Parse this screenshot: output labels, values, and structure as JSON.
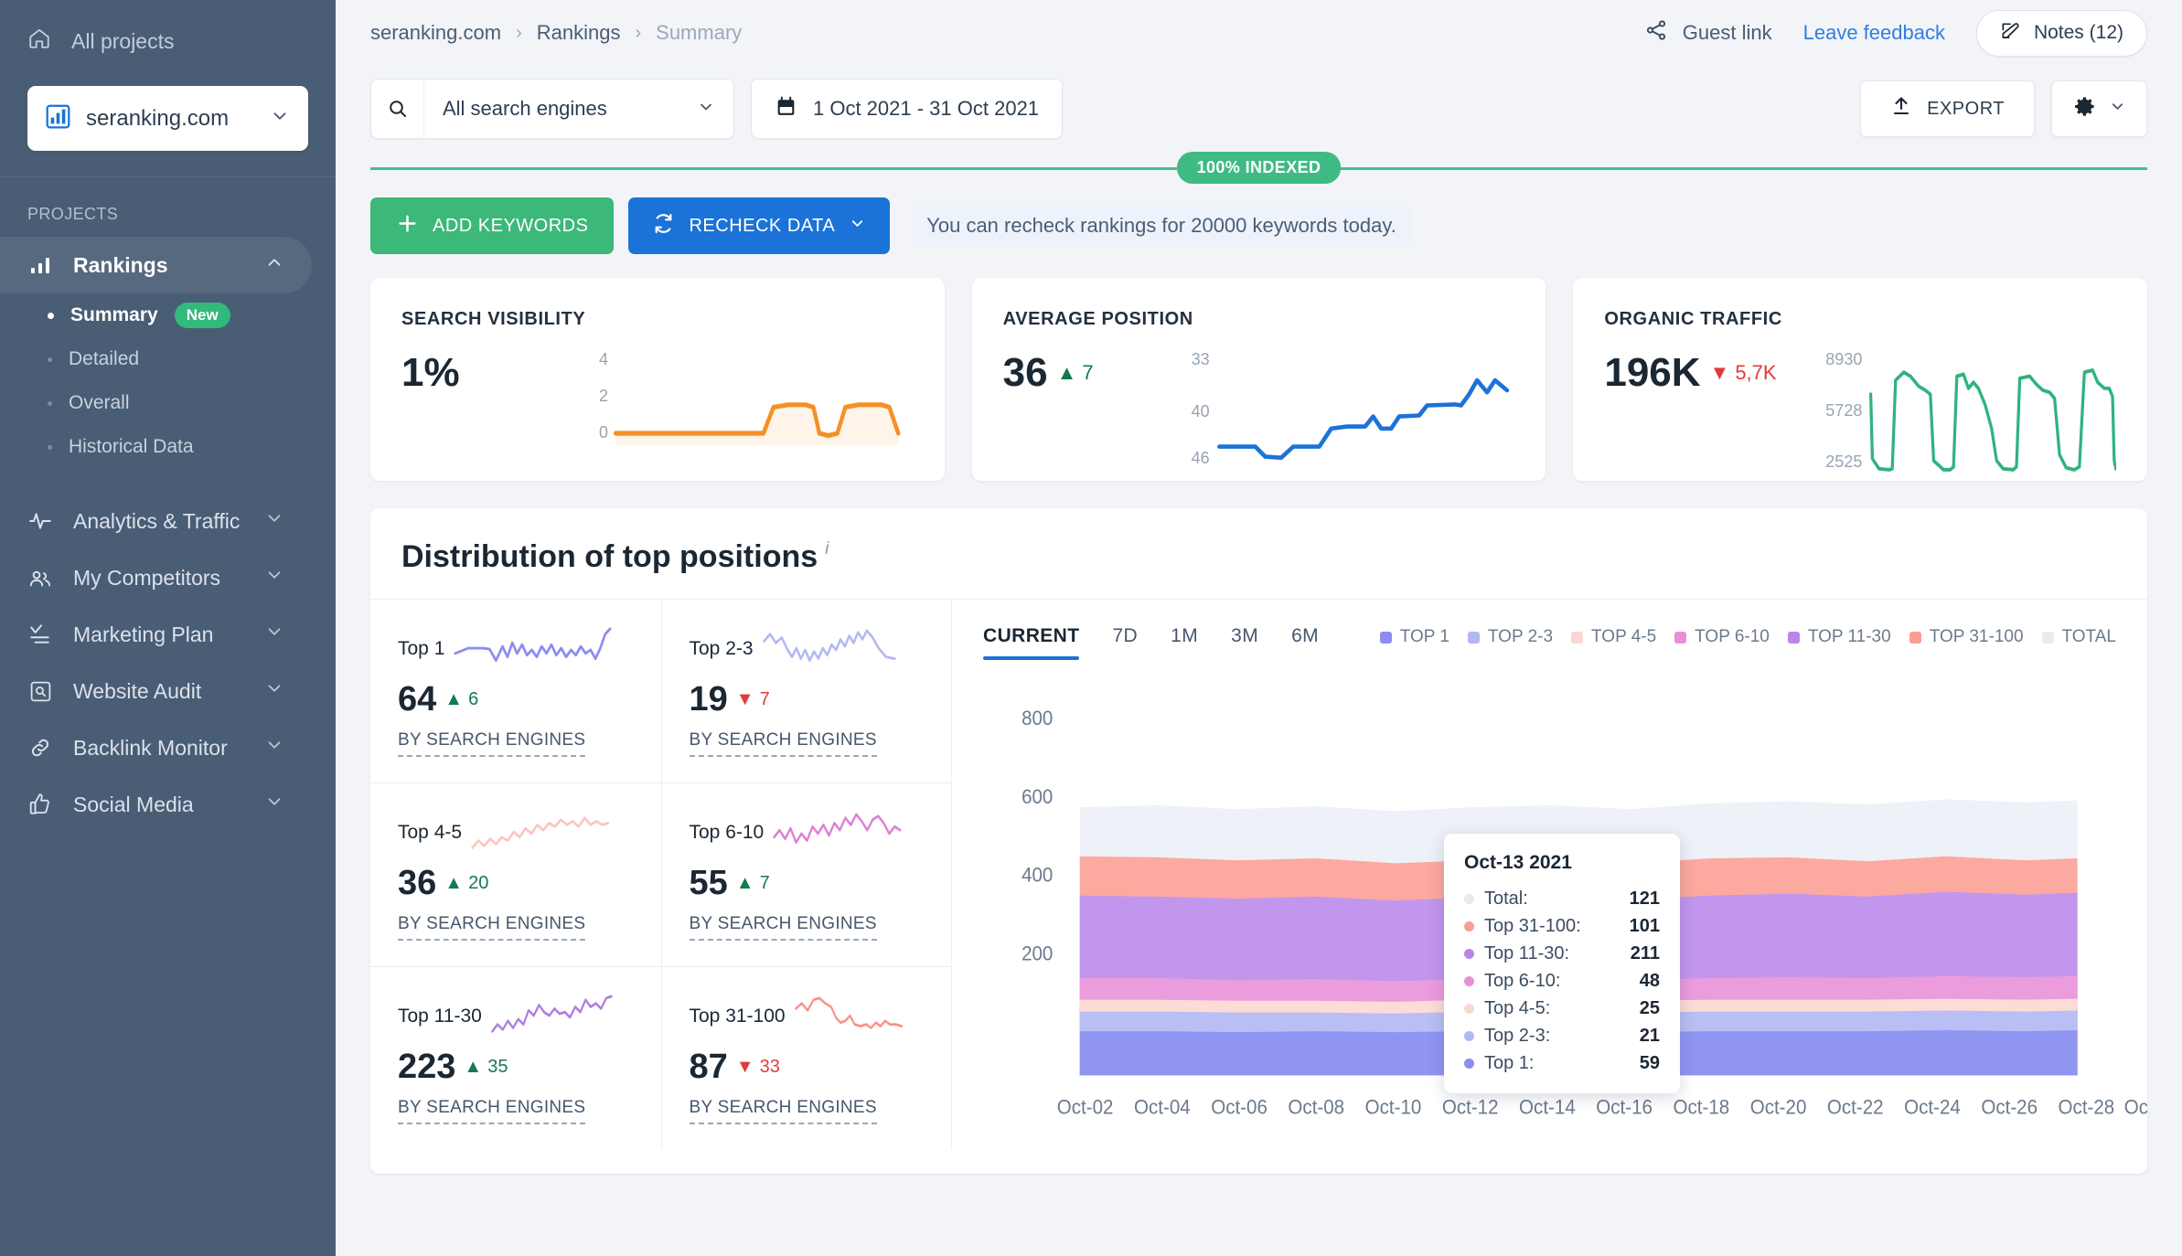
{
  "sidebar": {
    "all_projects": "All projects",
    "project": "seranking.com",
    "section_label": "PROJECTS",
    "items": [
      {
        "label": "Rankings",
        "icon": "bar-chart-icon",
        "active": true,
        "expanded": true
      },
      {
        "label": "Analytics & Traffic",
        "icon": "pulse-icon",
        "active": false,
        "expanded": false
      },
      {
        "label": "My Competitors",
        "icon": "people-icon",
        "active": false,
        "expanded": false
      },
      {
        "label": "Marketing Plan",
        "icon": "checklist-icon",
        "active": false,
        "expanded": false
      },
      {
        "label": "Website Audit",
        "icon": "magnifier-box-icon",
        "active": false,
        "expanded": false
      },
      {
        "label": "Backlink Monitor",
        "icon": "link-icon",
        "active": false,
        "expanded": false
      },
      {
        "label": "Social Media",
        "icon": "thumbs-up-icon",
        "active": false,
        "expanded": false
      }
    ],
    "rankings_sub": [
      {
        "label": "Summary",
        "badge": "New",
        "active": true
      },
      {
        "label": "Detailed",
        "badge": "",
        "active": false
      },
      {
        "label": "Overall",
        "badge": "",
        "active": false
      },
      {
        "label": "Historical Data",
        "badge": "",
        "active": false
      }
    ]
  },
  "header": {
    "breadcrumb": {
      "site": "seranking.com",
      "section": "Rankings",
      "current": "Summary"
    },
    "guest_link": "Guest link",
    "feedback": "Leave feedback",
    "notes": "Notes (12)"
  },
  "filters": {
    "search_engines": "All search engines",
    "date_range": "1 Oct 2021 - 31 Oct 2021",
    "export": "EXPORT"
  },
  "actions": {
    "indexed_badge": "100% INDEXED",
    "add_keywords": "ADD KEYWORDS",
    "recheck_data": "RECHECK DATA",
    "recheck_note": "You can recheck rankings for 20000 keywords today."
  },
  "kpis": [
    {
      "title": "SEARCH VISIBILITY",
      "value": "1%",
      "delta": "",
      "delta_dir": "none",
      "axis": [
        "4",
        "2",
        "0"
      ],
      "color": "#f59023"
    },
    {
      "title": "AVERAGE POSITION",
      "value": "36",
      "delta": "7",
      "delta_dir": "up",
      "axis": [
        "33",
        "40",
        "46"
      ],
      "color": "#1b72d8"
    },
    {
      "title": "ORGANIC TRAFFIC",
      "value": "196K",
      "delta": "5,7K",
      "delta_dir": "down",
      "axis": [
        "8930",
        "5728",
        "2525"
      ],
      "color": "#30b37e"
    }
  ],
  "distribution": {
    "title": "Distribution of top positions",
    "info_glyph": "i",
    "by_search_engines": "BY SEARCH ENGINES",
    "cells": [
      {
        "name": "Top 1",
        "value": "64",
        "delta": "6",
        "delta_dir": "up",
        "color": "#8b8df0"
      },
      {
        "name": "Top 2-3",
        "value": "19",
        "delta": "7",
        "delta_dir": "down",
        "color": "#b3b8f2"
      },
      {
        "name": "Top 4-5",
        "value": "36",
        "delta": "20",
        "delta_dir": "up",
        "color": "#fbc6bd"
      },
      {
        "name": "Top 6-10",
        "value": "55",
        "delta": "7",
        "delta_dir": "up",
        "color": "#e07fd4"
      },
      {
        "name": "Top 11-30",
        "value": "223",
        "delta": "35",
        "delta_dir": "up",
        "color": "#b07ee0"
      },
      {
        "name": "Top 31-100",
        "value": "87",
        "delta": "33",
        "delta_dir": "down",
        "color": "#fa9188"
      }
    ]
  },
  "chart_data": {
    "type": "area",
    "title": "Distribution of top positions",
    "xlabel": "",
    "ylabel": "",
    "ylim": [
      0,
      900
    ],
    "yticks": [
      200,
      400,
      600,
      800
    ],
    "grid": false,
    "legend_position": "top-right",
    "tabs": [
      {
        "label": "CURRENT",
        "active": true
      },
      {
        "label": "7D",
        "active": false
      },
      {
        "label": "1M",
        "active": false
      },
      {
        "label": "3M",
        "active": false
      },
      {
        "label": "6M",
        "active": false
      }
    ],
    "legend": [
      {
        "name": "TOP 1",
        "color": "#8b8df0"
      },
      {
        "name": "TOP 2-3",
        "color": "#b3b8f2"
      },
      {
        "name": "TOP 4-5",
        "color": "#fbd7d1"
      },
      {
        "name": "TOP 6-10",
        "color": "#e98fd8"
      },
      {
        "name": "TOP 11-30",
        "color": "#b886ea"
      },
      {
        "name": "TOP 31-100",
        "color": "#fa9d92"
      },
      {
        "name": "TOTAL",
        "color": "#eef1f7"
      }
    ],
    "x": [
      "Oct-02",
      "Oct-04",
      "Oct-06",
      "Oct-08",
      "Oct-10",
      "Oct-12",
      "Oct-14",
      "Oct-16",
      "Oct-18",
      "Oct-20",
      "Oct-22",
      "Oct-24",
      "Oct-26",
      "Oct-28",
      "Oct-"
    ],
    "series": [
      {
        "name": "TOP 1",
        "color": "#8b8df0",
        "values": [
          59,
          59,
          60,
          59,
          60,
          59,
          59,
          60,
          61,
          60,
          61,
          62,
          62,
          63,
          64
        ]
      },
      {
        "name": "TOP 2-3",
        "color": "#b3b8f2",
        "values": [
          21,
          21,
          22,
          21,
          21,
          21,
          21,
          20,
          20,
          20,
          20,
          19,
          19,
          19,
          19
        ]
      },
      {
        "name": "TOP 4-5",
        "color": "#fbd7d1",
        "values": [
          25,
          25,
          26,
          26,
          26,
          25,
          25,
          27,
          28,
          30,
          31,
          33,
          34,
          35,
          36
        ]
      },
      {
        "name": "TOP 6-10",
        "color": "#e98fd8",
        "values": [
          48,
          48,
          49,
          49,
          50,
          49,
          48,
          50,
          51,
          52,
          53,
          54,
          54,
          55,
          55
        ]
      },
      {
        "name": "TOP 11-30",
        "color": "#b886ea",
        "values": [
          211,
          212,
          214,
          213,
          215,
          212,
          211,
          214,
          216,
          218,
          219,
          221,
          222,
          223,
          223
        ]
      },
      {
        "name": "TOP 31-100",
        "color": "#fa9d92",
        "values": [
          101,
          100,
          99,
          98,
          97,
          96,
          101,
          95,
          93,
          92,
          90,
          89,
          88,
          87,
          87
        ]
      },
      {
        "name": "TOTAL",
        "color": "#eef1f7",
        "values": [
          121,
          121,
          120,
          121,
          120,
          121,
          121,
          120,
          119,
          119,
          118,
          118,
          117,
          117,
          117
        ]
      }
    ],
    "tooltip": {
      "date": "Oct-13 2021",
      "rows": [
        {
          "label": "Total:",
          "value": "121",
          "color": "#e8ebf2"
        },
        {
          "label": "Top 31-100:",
          "value": "101",
          "color": "#fa9d92"
        },
        {
          "label": "Top 11-30:",
          "value": "211",
          "color": "#b886ea"
        },
        {
          "label": "Top 6-10:",
          "value": "48",
          "color": "#e98fd8"
        },
        {
          "label": "Top 4-5:",
          "value": "25",
          "color": "#fbd7d1"
        },
        {
          "label": "Top 2-3:",
          "value": "21",
          "color": "#b3b8f2"
        },
        {
          "label": "Top 1:",
          "value": "59",
          "color": "#8b8df0"
        }
      ]
    }
  }
}
